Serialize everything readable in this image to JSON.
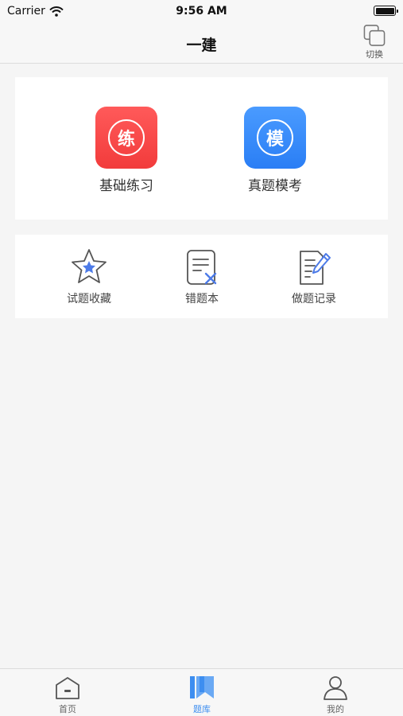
{
  "status_bar": {
    "carrier": "Carrier",
    "time": "9:56 AM"
  },
  "nav": {
    "title": "一建",
    "switch_label": "切换"
  },
  "modes": [
    {
      "glyph": "练",
      "label": "基础练习",
      "color": "#f44444"
    },
    {
      "glyph": "模",
      "label": "真题模考",
      "color": "#2f86f8"
    }
  ],
  "tools": [
    {
      "label": "试题收藏",
      "icon": "star-icon"
    },
    {
      "label": "错题本",
      "icon": "wrong-book-icon"
    },
    {
      "label": "做题记录",
      "icon": "record-edit-icon"
    }
  ],
  "tabs": [
    {
      "label": "首页",
      "icon": "home-icon",
      "active": false
    },
    {
      "label": "题库",
      "icon": "question-bank-icon",
      "active": true
    },
    {
      "label": "我的",
      "icon": "profile-icon",
      "active": false
    }
  ],
  "colors": {
    "accent": "#3d8ef0",
    "icon_blue": "#4d7be8"
  }
}
